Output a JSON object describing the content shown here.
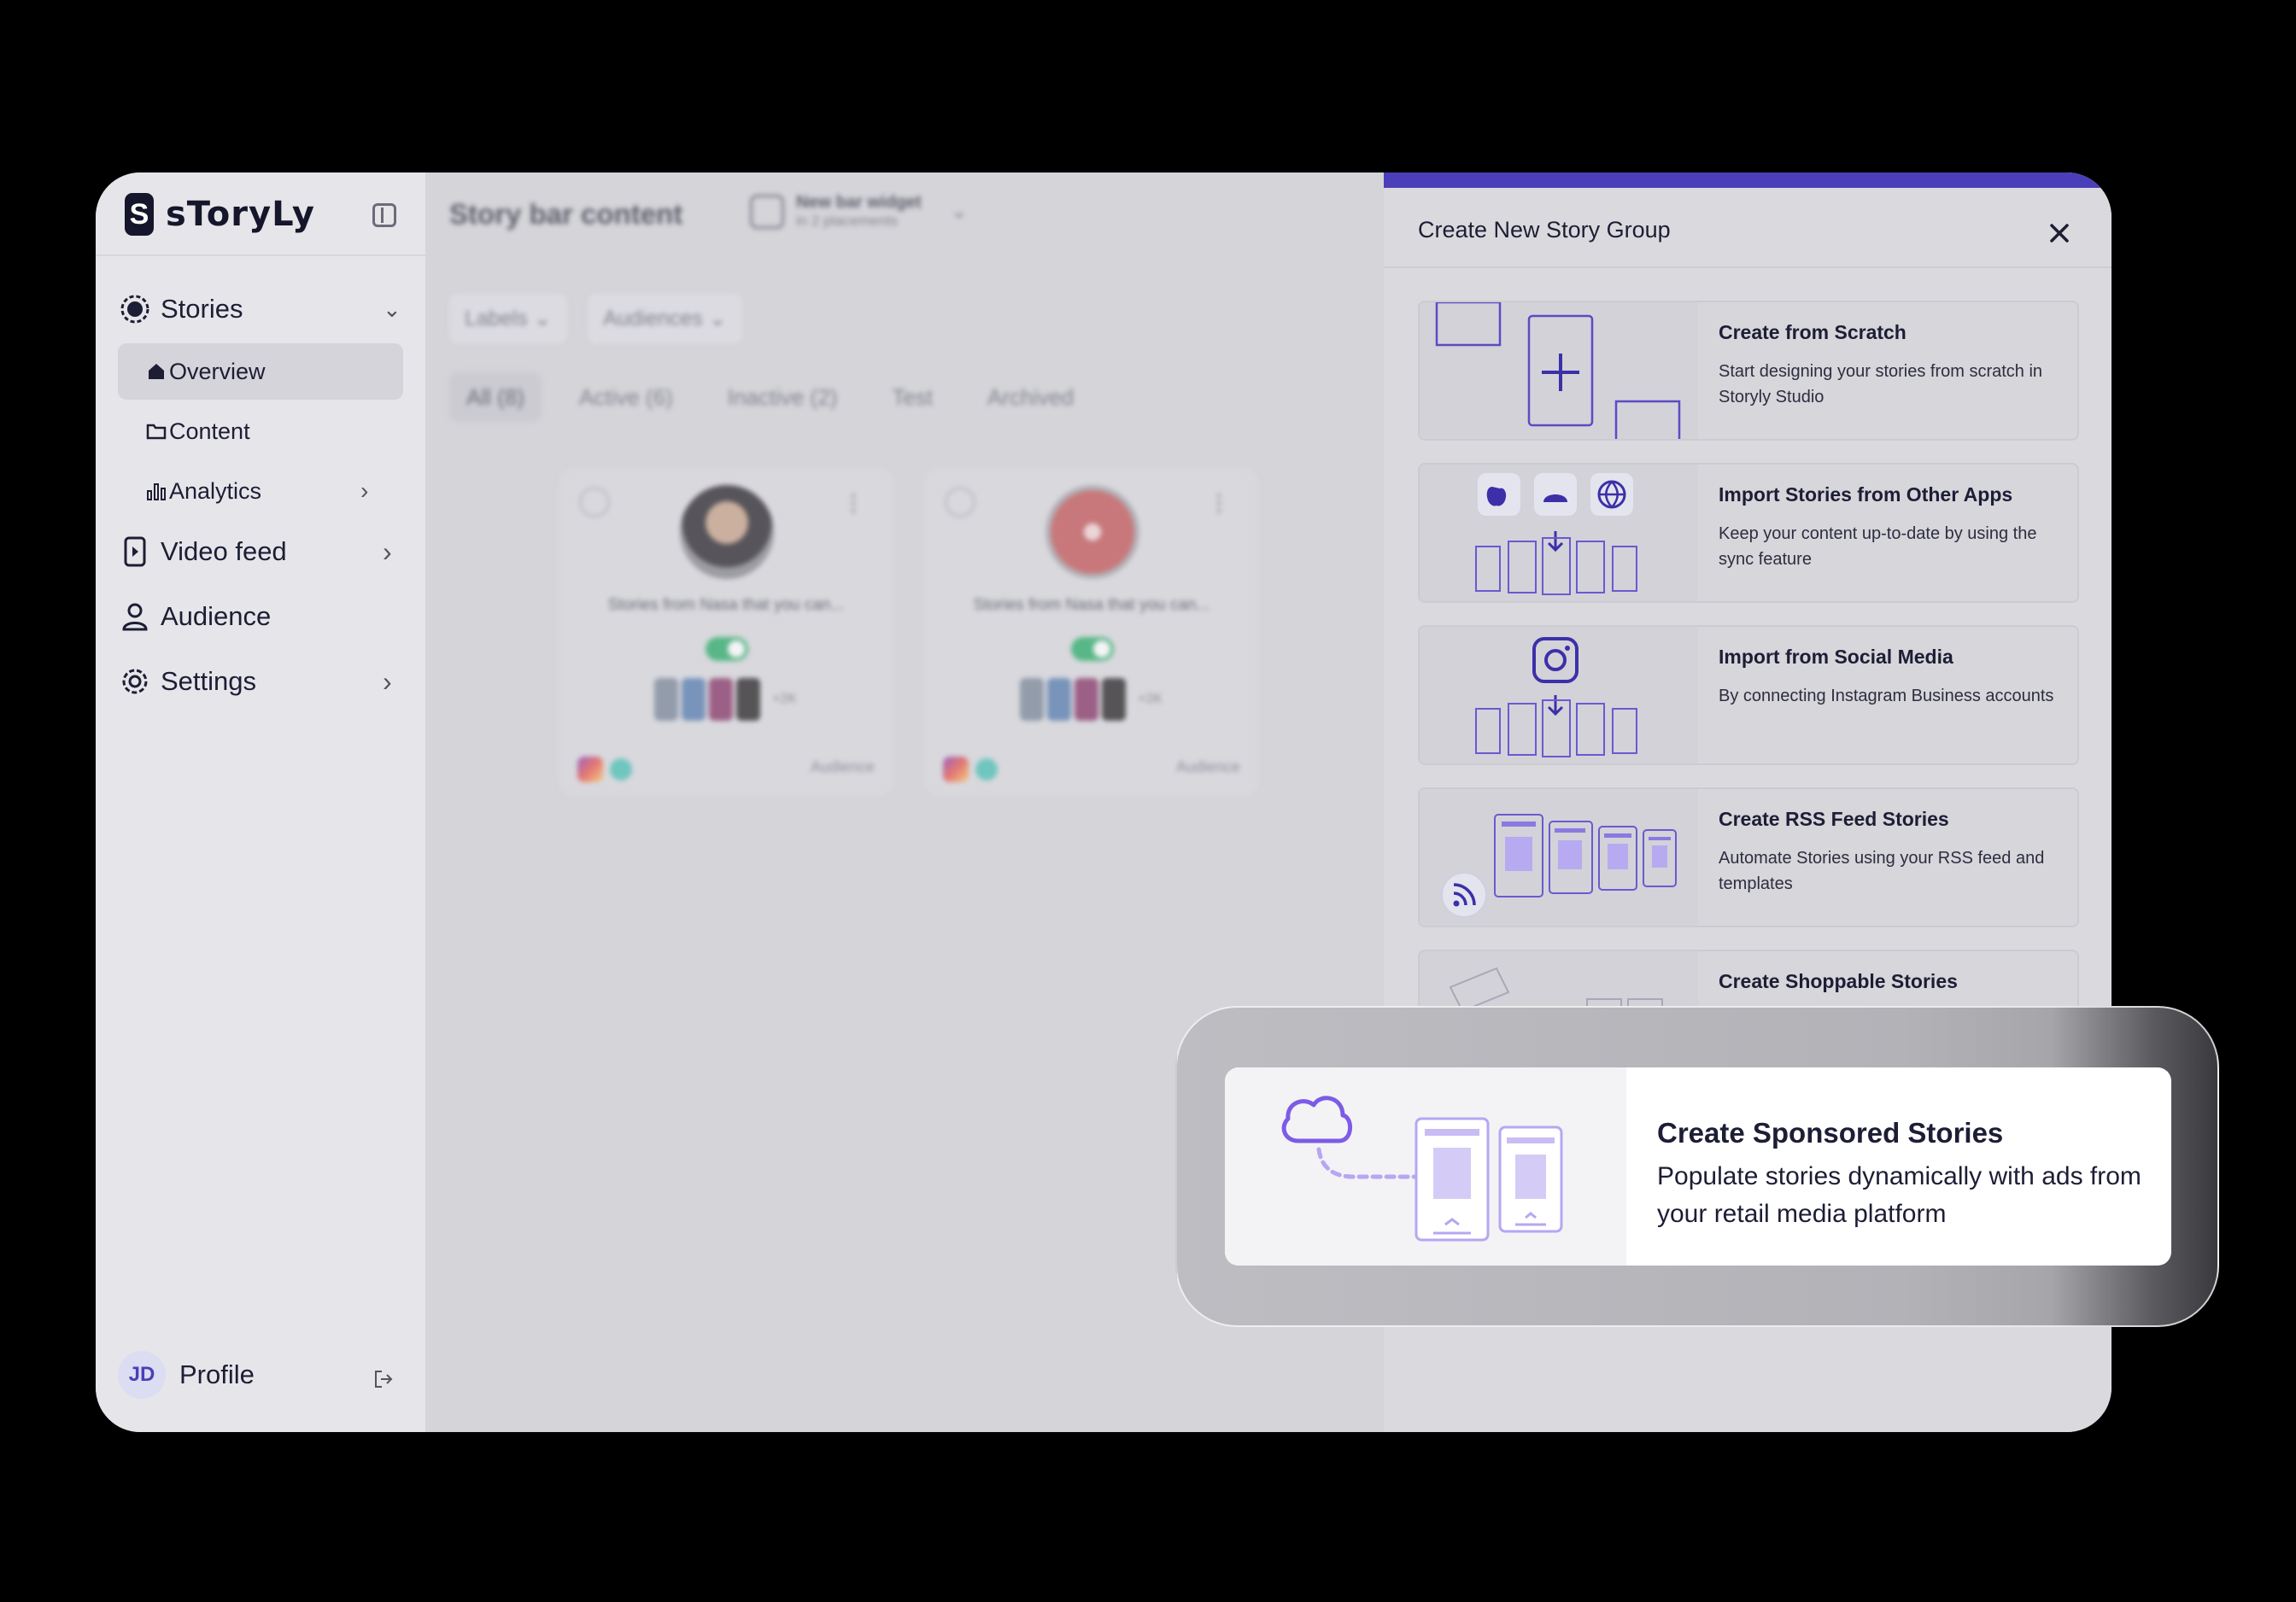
{
  "brand": {
    "logo_letter": "S",
    "name": "sToryLy"
  },
  "sidebar": {
    "items": [
      {
        "label": "Stories"
      },
      {
        "label": "Video feed"
      },
      {
        "label": "Audience"
      },
      {
        "label": "Settings"
      }
    ],
    "subitems": [
      {
        "label": "Overview"
      },
      {
        "label": "Content"
      },
      {
        "label": "Analytics"
      }
    ],
    "profile": {
      "initials": "JD",
      "label": "Profile"
    }
  },
  "main": {
    "title": "Story bar content",
    "widget": {
      "name": "New bar widget",
      "sub": "in 2 placements"
    },
    "filters": [
      "Labels",
      "Audiences"
    ],
    "tabs": [
      "All (8)",
      "Active (6)",
      "Inactive (2)",
      "Test",
      "Archived"
    ],
    "cards": [
      {
        "name": "Stories from Nasa that you can...",
        "more": "+2K",
        "audience": "Audience"
      },
      {
        "name": "Stories from Nasa that you can...",
        "more": "+2K",
        "audience": "Audience"
      }
    ]
  },
  "panel": {
    "title": "Create New Story Group",
    "options": [
      {
        "title": "Create from Scratch",
        "desc": "Start designing your stories from scratch in Storyly Studio"
      },
      {
        "title": "Import Stories from Other Apps",
        "desc": "Keep your content up-to-date by using the sync feature"
      },
      {
        "title": "Import from Social Media",
        "desc": "By connecting Instagram Business accounts"
      },
      {
        "title": "Create RSS Feed Stories",
        "desc": "Automate Stories using your RSS feed and templates"
      },
      {
        "title": "Create Shoppable Stories",
        "desc": ""
      }
    ]
  },
  "highlight": {
    "title": "Create Sponsored Stories",
    "desc": "Populate stories dynamically with ads from your retail media platform"
  },
  "colors": {
    "accent": "#4a3fb8",
    "illustration": "#7c5ce6",
    "toggle_on": "#2fae6a"
  }
}
